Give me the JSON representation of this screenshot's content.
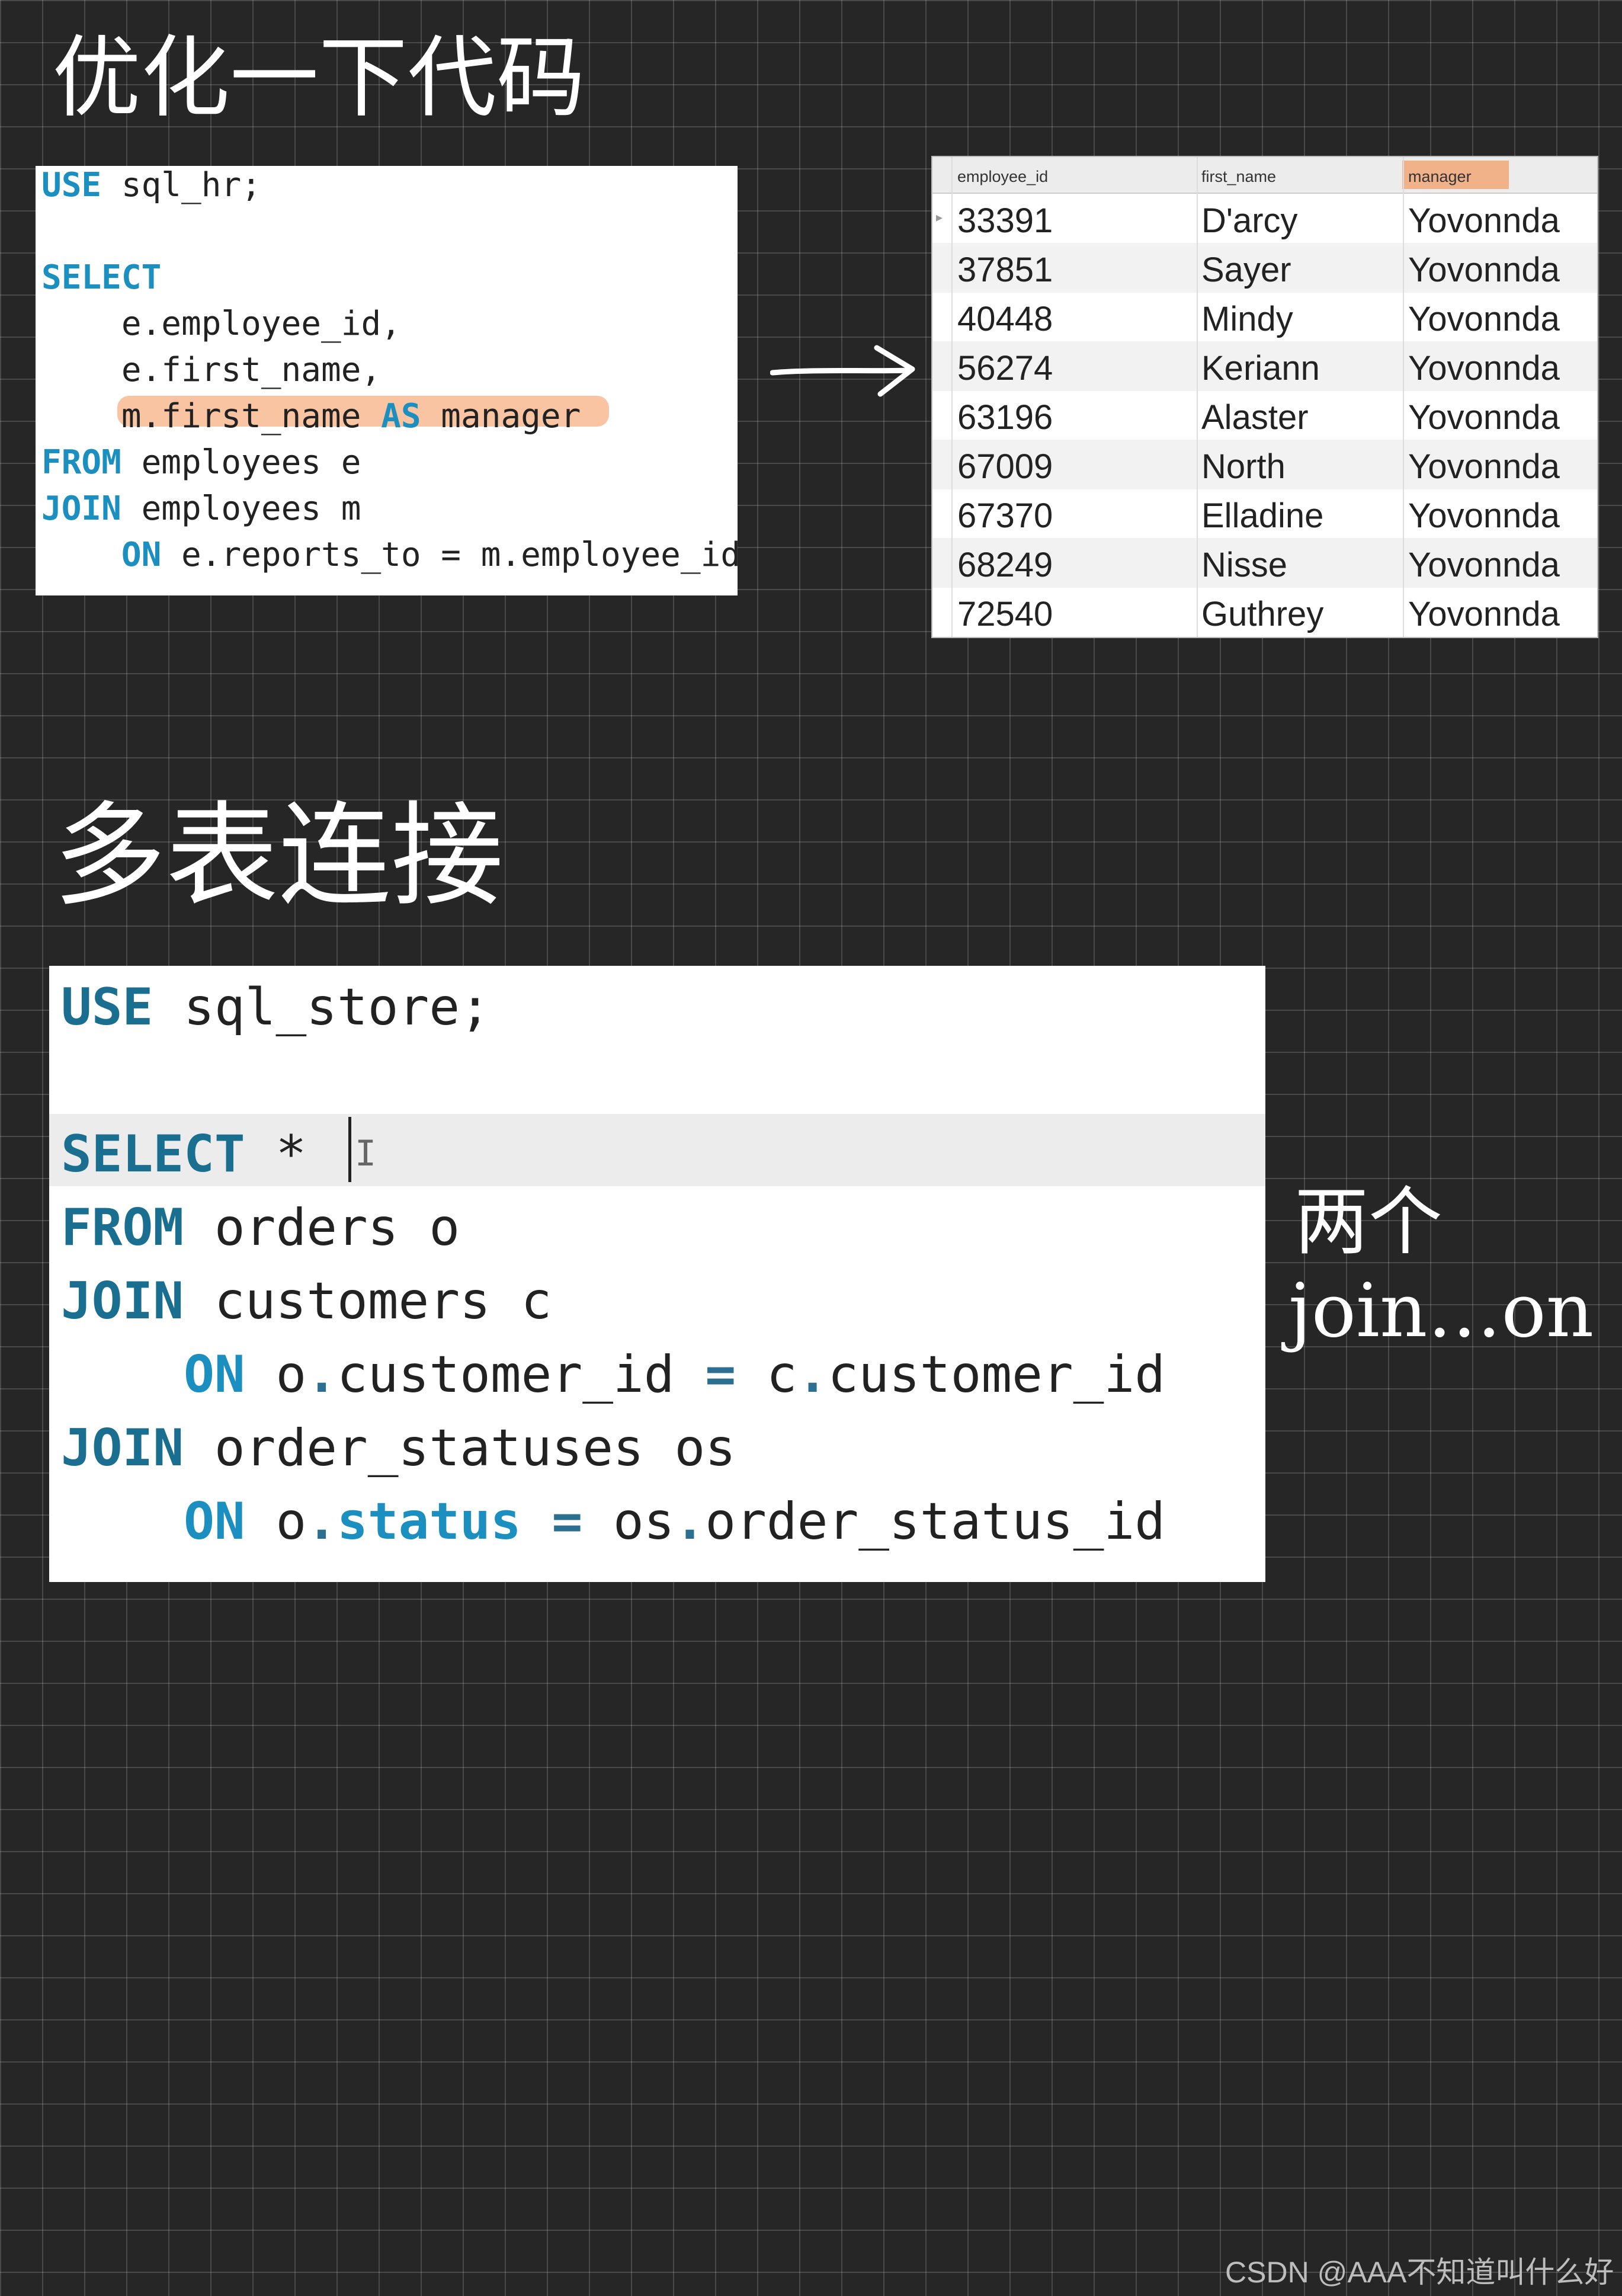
{
  "notes": {
    "top_title": "优化一下代码",
    "middle_title": "多表连接",
    "side_note_line1": "两个",
    "side_note_line2": "join…on"
  },
  "sql1": {
    "lines": [
      {
        "kw": "USE",
        "rest": " sql_hr;"
      },
      {
        "kw": "",
        "rest": ""
      },
      {
        "kw": "SELECT",
        "rest": ""
      },
      {
        "kw": "",
        "rest": "    e.employee_id,"
      },
      {
        "kw": "",
        "rest": "    e.first_name,"
      },
      {
        "pre": "    m.first_name ",
        "kw": "AS",
        "rest": " manager"
      },
      {
        "kw": "FROM",
        "rest": " employees e"
      },
      {
        "kw": "JOIN",
        "rest": " employees m"
      },
      {
        "pre": "    ",
        "kw": "ON",
        "rest": " e.reports_to = m.employee_id"
      }
    ]
  },
  "result_table": {
    "columns": [
      "employee_id",
      "first_name",
      "manager"
    ],
    "rows": [
      [
        "33391",
        "D'arcy",
        "Yovonnda"
      ],
      [
        "37851",
        "Sayer",
        "Yovonnda"
      ],
      [
        "40448",
        "Mindy",
        "Yovonnda"
      ],
      [
        "56274",
        "Keriann",
        "Yovonnda"
      ],
      [
        "63196",
        "Alaster",
        "Yovonnda"
      ],
      [
        "67009",
        "North",
        "Yovonnda"
      ],
      [
        "67370",
        "Elladine",
        "Yovonnda"
      ],
      [
        "68249",
        "Nisse",
        "Yovonnda"
      ],
      [
        "72540",
        "Guthrey",
        "Yovonnda"
      ]
    ]
  },
  "sql2": {
    "line1_kw": "USE",
    "line1_rest": " sql_store;",
    "line3_kw": "SELECT",
    "line3_rest": " *",
    "line4_kw": "FROM",
    "line4_rest": " orders o",
    "line5_kw": "JOIN",
    "line5_rest": " customers c",
    "line6_kw": "ON",
    "line6_a": " o",
    "line6_dot": ".",
    "line6_b": "customer_id ",
    "line6_eq": "=",
    "line6_c": " c",
    "line6_dot2": ".",
    "line6_d": "customer_id",
    "line7_kw": "JOIN",
    "line7_rest": " order_statuses os",
    "line8_kw": "ON",
    "line8_a": " o",
    "line8_dot": ".",
    "line8_status": "status",
    "line8_eq": " = ",
    "line8_c": "os",
    "line8_dot2": ".",
    "line8_d": "order_status_id"
  },
  "watermark": "CSDN @AAA不知道叫什么好"
}
